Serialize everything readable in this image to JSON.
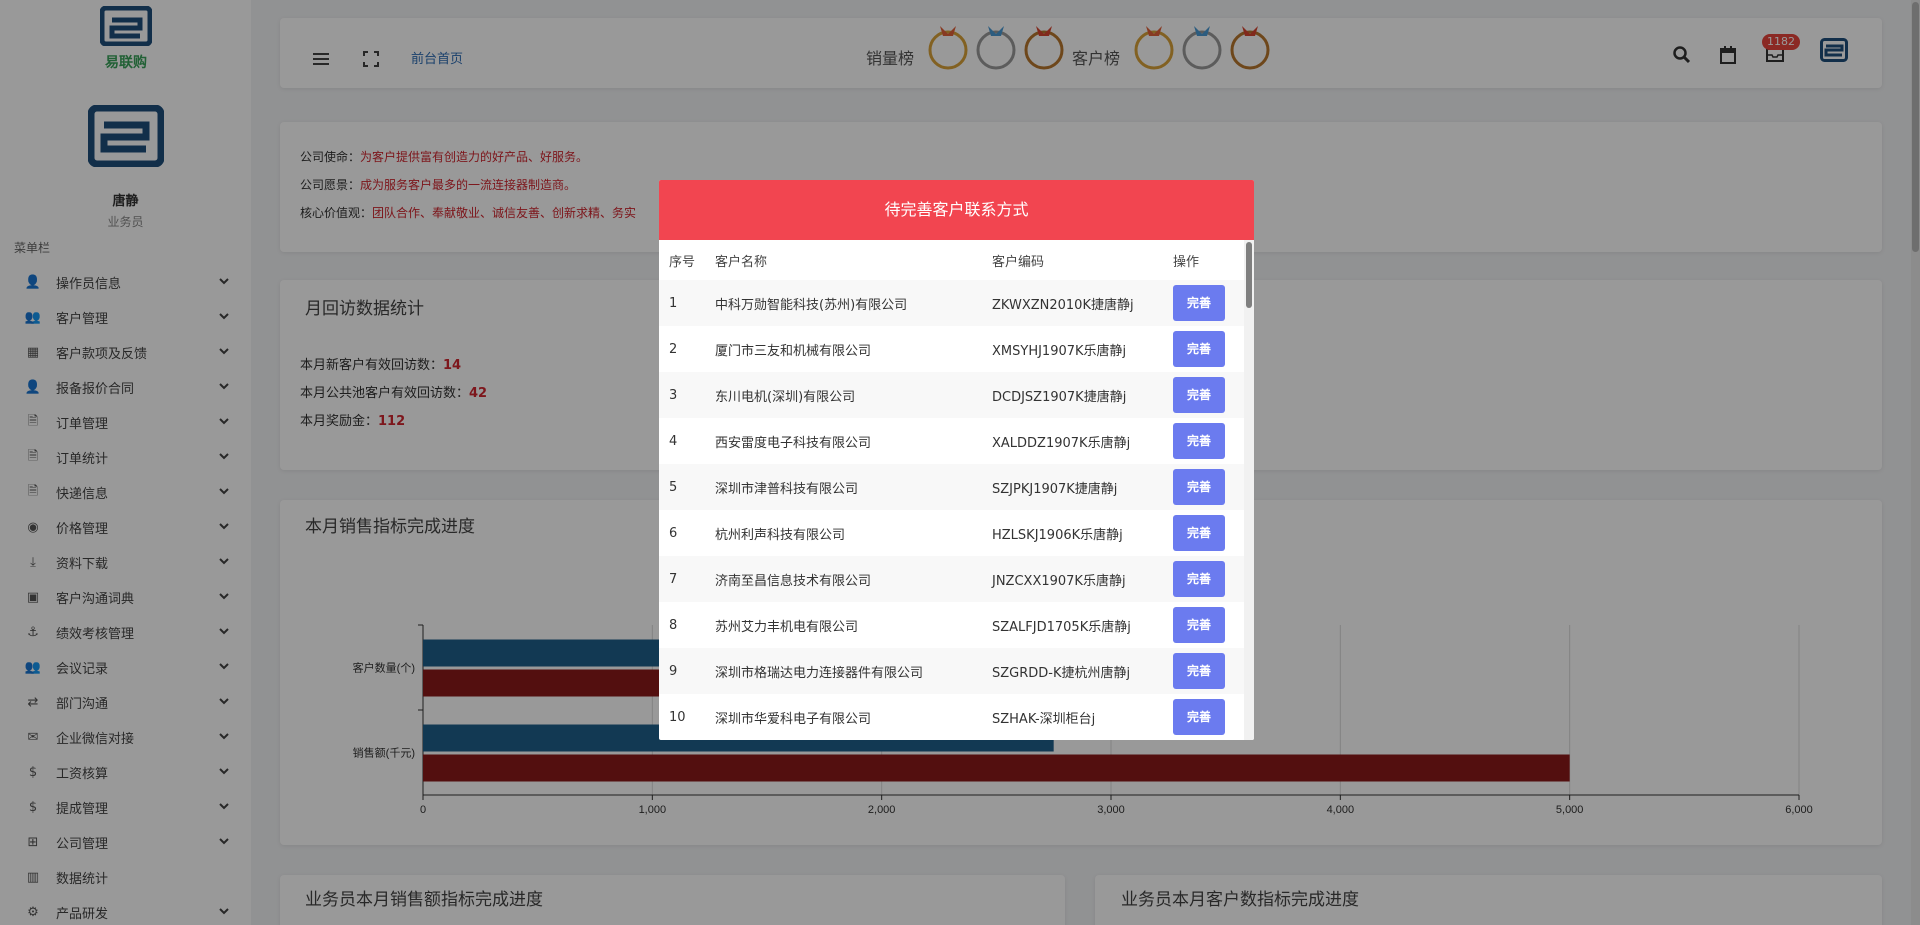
{
  "brand": {
    "name": "易联购",
    "color": "#1e4f7c"
  },
  "user": {
    "name": "唐静",
    "role": "业务员"
  },
  "menu_title": "菜单栏",
  "menu": [
    {
      "label": "操作员信息",
      "icon": "user-edit-icon",
      "glyph": "👤",
      "chevron": true
    },
    {
      "label": "客户管理",
      "icon": "users-icon",
      "glyph": "👥",
      "chevron": true
    },
    {
      "label": "客户款项及反馈",
      "icon": "table-icon",
      "glyph": "▦",
      "chevron": true
    },
    {
      "label": "报备报价合同",
      "icon": "user-lock-icon",
      "glyph": "👤",
      "chevron": true
    },
    {
      "label": "订单管理",
      "icon": "file-icon",
      "glyph": "🗎",
      "chevron": true
    },
    {
      "label": "订单统计",
      "icon": "file-alt-icon",
      "glyph": "🗎",
      "chevron": true
    },
    {
      "label": "快递信息",
      "icon": "file-text-icon",
      "glyph": "🗎",
      "chevron": true
    },
    {
      "label": "价格管理",
      "icon": "price-icon",
      "glyph": "◉",
      "chevron": true
    },
    {
      "label": "资料下载",
      "icon": "download-icon",
      "glyph": "⤓",
      "chevron": true
    },
    {
      "label": "客户沟通词典",
      "icon": "book-icon",
      "glyph": "▣",
      "chevron": true
    },
    {
      "label": "绩效考核管理",
      "icon": "performance-icon",
      "glyph": "⚓",
      "chevron": true
    },
    {
      "label": "会议记录",
      "icon": "meeting-icon",
      "glyph": "👥",
      "chevron": true
    },
    {
      "label": "部门沟通",
      "icon": "exchange-icon",
      "glyph": "⇄",
      "chevron": true
    },
    {
      "label": "企业微信对接",
      "icon": "wechat-icon",
      "glyph": "✉",
      "chevron": true
    },
    {
      "label": "工资核算",
      "icon": "dollar-icon",
      "glyph": "$",
      "chevron": true
    },
    {
      "label": "提成管理",
      "icon": "dollar-icon",
      "glyph": "$",
      "chevron": true
    },
    {
      "label": "公司管理",
      "icon": "sitemap-icon",
      "glyph": "⊞",
      "chevron": true
    },
    {
      "label": "数据统计",
      "icon": "chart-icon",
      "glyph": "▥",
      "chevron": false
    },
    {
      "label": "产品研发",
      "icon": "product-icon",
      "glyph": "⚙",
      "chevron": true
    }
  ],
  "topbar": {
    "home_link": "前台首页",
    "sales_rank": "销量榜",
    "customer_rank": "客户榜",
    "mail_badge": "1182"
  },
  "mission": {
    "mission_label": "公司使命：",
    "mission_text": "为客户提供富有创造力的好产品、好服务。",
    "vision_label": "公司愿景：",
    "vision_text": "成为服务客户最多的一流连接器制造商。",
    "values_label": "核心价值观：",
    "values_text": "团队合作、奉献敬业、诚信友善、创新求精、务实"
  },
  "visits": {
    "title": "月回访数据统计",
    "new_label": "本月新客户有效回访数：",
    "new_value": "14",
    "pool_label": "本月公共池客户有效回访数：",
    "pool_value": "42",
    "bonus_label": "本月奖励金：",
    "bonus_value": "112"
  },
  "sales_section": {
    "title": "本月销售指标完成进度"
  },
  "chart_data": {
    "type": "bar",
    "orientation": "horizontal",
    "categories": [
      "客户数量(个)",
      "销售额(千元)"
    ],
    "series": [
      {
        "color": "#1f5f8b",
        "values": [
          null,
          2750
        ]
      },
      {
        "color": "#8b1a1a",
        "values": [
          null,
          5000
        ]
      }
    ],
    "xticks": [
      "0",
      "1,000",
      "2,000",
      "3,000",
      "4,000",
      "5,000",
      "6,000"
    ],
    "xlim": [
      0,
      6000
    ],
    "grid": true
  },
  "bottom": {
    "left_title": "业务员本月销售额指标完成进度",
    "right_title": "业务员本月客户数指标完成进度"
  },
  "modal": {
    "title": "待完善客户联系方式",
    "headers": [
      "序号",
      "客户名称",
      "客户编码",
      "操作"
    ],
    "button_label": "完善",
    "rows": [
      {
        "no": "1",
        "name": "中科万勋智能科技(苏州)有限公司",
        "code": "ZKWXZN2010K捷唐静j"
      },
      {
        "no": "2",
        "name": "厦门市三友和机械有限公司",
        "code": "XMSYHJ1907K乐唐静j"
      },
      {
        "no": "3",
        "name": "东川电机(深圳)有限公司",
        "code": "DCDJSZ1907K捷唐静j"
      },
      {
        "no": "4",
        "name": "西安雷度电子科技有限公司",
        "code": "XALDDZ1907K乐唐静j"
      },
      {
        "no": "5",
        "name": "深圳市津普科技有限公司",
        "code": "SZJPKJ1907K捷唐静j"
      },
      {
        "no": "6",
        "name": "杭州利声科技有限公司",
        "code": "HZLSKJ1906K乐唐静j"
      },
      {
        "no": "7",
        "name": "济南至昌信息技术有限公司",
        "code": "JNZCXX1907K乐唐静j"
      },
      {
        "no": "8",
        "name": "苏州艾力丰机电有限公司",
        "code": "SZALFJD1705K乐唐静j"
      },
      {
        "no": "9",
        "name": "深圳市格瑞达电力连接器件有限公司",
        "code": "SZGRDD-K捷杭州唐静j"
      },
      {
        "no": "10",
        "name": "深圳市华爱科电子有限公司",
        "code": "SZHAK-深圳柜台j"
      }
    ]
  }
}
